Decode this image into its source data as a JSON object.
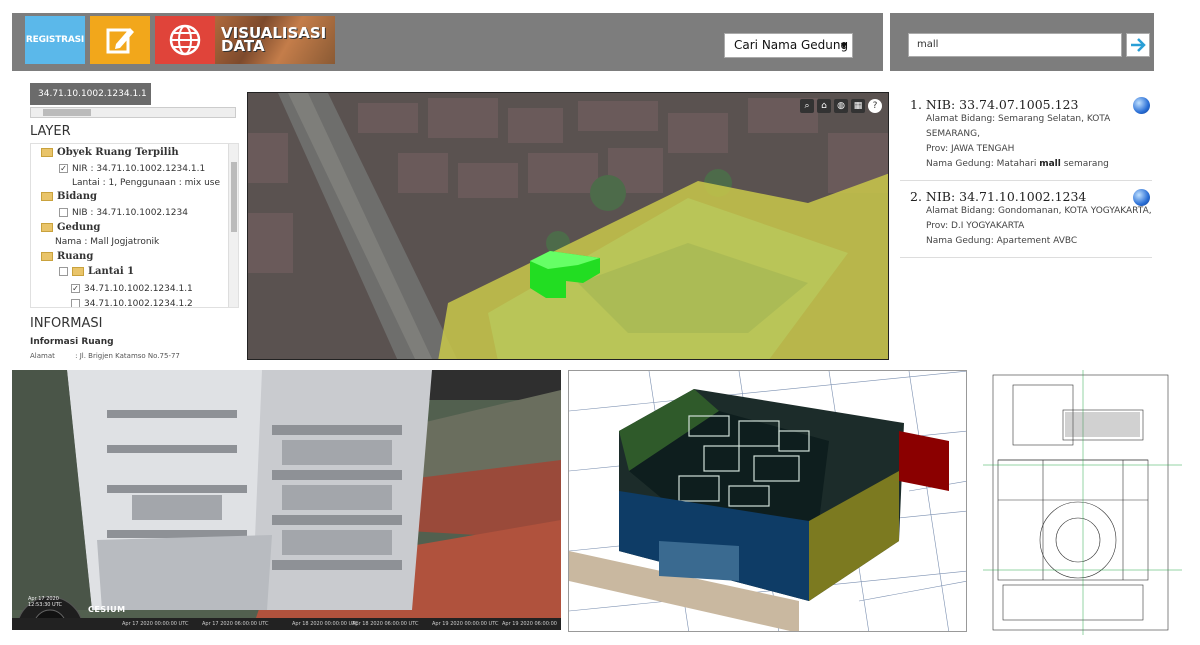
{
  "header": {
    "registrasi_label": "REGISTRASI",
    "edit_icon": "edit-icon",
    "globe_icon": "globe-icon",
    "visualisasi_label_1": "VISUALISASI",
    "visualisasi_label_2": "DATA",
    "select_value": "Cari Nama Gedung",
    "search_value": "mall"
  },
  "left_panel": {
    "tab_label": "34.71.10.1002.1234.1.1",
    "layer_title": "LAYER",
    "tree": {
      "obyek_head": "Obyek Ruang Terpilih",
      "obyek_nir": "NIR : 34.71.10.1002.1234.1.1",
      "obyek_detail": "Lantai : 1, Penggunaan : mix use",
      "bidang_head": "Bidang",
      "bidang_nib": "NIB : 34.71.10.1002.1234",
      "gedung_head": "Gedung",
      "gedung_nama": "Nama : Mall Jogjatronik",
      "ruang_head": "Ruang",
      "lantai_head": "Lantai 1",
      "ruang_1": "34.71.10.1002.1234.1.1",
      "ruang_2": "34.71.10.1002.1234.1.2"
    },
    "info_title": "INFORMASI",
    "info_sub": "Informasi Ruang",
    "info_row_label": "Alamat",
    "info_row_value": ": Jl. Brigjen Katamso No.75-77"
  },
  "results": [
    {
      "nib": "1. NIB: 33.74.07.1005.123",
      "alamat": "Alamat Bidang: Semarang Selatan, KOTA SEMARANG,",
      "prov": "Prov: JAWA TENGAH",
      "gedung_prefix": "Nama Gedung: Matahari ",
      "gedung_bold": "mall",
      "gedung_suffix": " semarang"
    },
    {
      "nib": "2. NIB: 34.71.10.1002.1234",
      "alamat": "Alamat Bidang: Gondomanan, KOTA YOGYAKARTA,",
      "prov": "Prov: D.I YOGYAKARTA",
      "gedung": "Nama Gedung: Apartement AVBC"
    }
  ],
  "cesium": {
    "logo": "CESIUM",
    "clock_date": "Apr 17 2020",
    "clock_time": "12:53:30 UTC",
    "timeline": [
      "Apr 17 2020 00:00:00 UTC",
      "Apr 17 2020 06:00:00 UTC",
      "Apr 18 2020 00:00:00 UTC",
      "Apr 18 2020 06:00:00 UTC",
      "Apr 19 2020 00:00:00 UTC",
      "Apr 19 2020 06:00:00 UTC"
    ]
  },
  "colors": {
    "header_gray": "#7d7d7d",
    "registrasi": "#5bb8ea",
    "edit": "#f2a71b",
    "globe": "#e0443a"
  }
}
